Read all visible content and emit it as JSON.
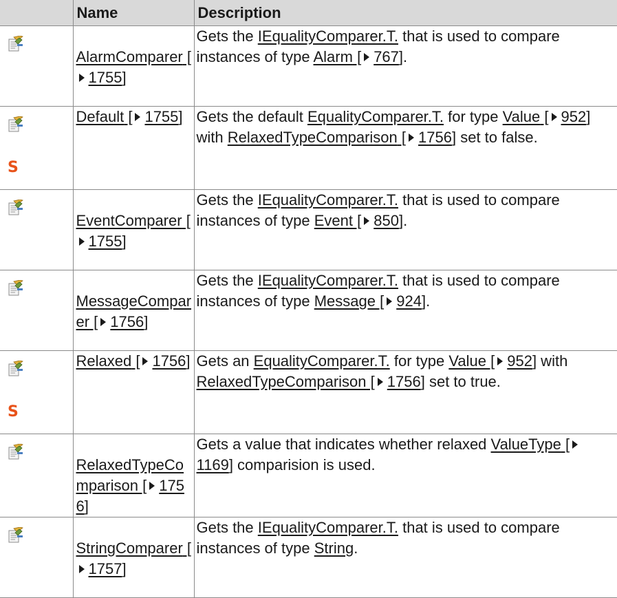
{
  "header": {
    "col_icon": "",
    "col_name": "Name",
    "col_desc": "Description"
  },
  "static_letter": "S",
  "rows": [
    {
      "name": {
        "text": "AlarmComparer",
        "ref": "1755"
      },
      "desc": [
        {
          "t": "Gets the "
        },
        {
          "t": "IEqualityComparer.T.",
          "link": true
        },
        {
          "t": " that is used to compare instances of type "
        },
        {
          "t": "Alarm",
          "link": true,
          "ref": "767"
        },
        {
          "t": "."
        }
      ]
    },
    {
      "name": {
        "text": "Default",
        "ref": "1755"
      },
      "static": true,
      "desc": [
        {
          "t": "Gets the default "
        },
        {
          "t": "EqualityComparer.T.",
          "link": true
        },
        {
          "t": " for type "
        },
        {
          "t": "Value",
          "link": true,
          "ref": "952"
        },
        {
          "t": " with "
        },
        {
          "t": "RelaxedTypeComparison",
          "link": true,
          "ref": "1756"
        },
        {
          "t": " set to false."
        }
      ]
    },
    {
      "name": {
        "text": "EventComparer",
        "ref": "1755"
      },
      "desc": [
        {
          "t": "Gets the "
        },
        {
          "t": "IEqualityComparer.T.",
          "link": true
        },
        {
          "t": " that is used to compare instances of type "
        },
        {
          "t": "Event",
          "link": true,
          "ref": "850"
        },
        {
          "t": "."
        }
      ]
    },
    {
      "name": {
        "text": "MessageComparer",
        "ref": "1756"
      },
      "desc": [
        {
          "t": "Gets the "
        },
        {
          "t": "IEqualityComparer.T.",
          "link": true
        },
        {
          "t": " that is used to compare instances of type "
        },
        {
          "t": "Message",
          "link": true,
          "ref": "924"
        },
        {
          "t": "."
        }
      ]
    },
    {
      "name": {
        "text": "Relaxed",
        "ref": "1756"
      },
      "static": true,
      "desc": [
        {
          "t": "Gets an "
        },
        {
          "t": "EqualityComparer.T.",
          "link": true
        },
        {
          "t": " for type "
        },
        {
          "t": "Value",
          "link": true,
          "ref": "952"
        },
        {
          "t": " with "
        },
        {
          "t": "RelaxedTypeComparison",
          "link": true,
          "ref": "1756"
        },
        {
          "t": " set to true."
        }
      ]
    },
    {
      "name": {
        "text": "RelaxedTypeComparison",
        "ref": "1756"
      },
      "desc": [
        {
          "t": "Gets a value that indicates whether relaxed "
        },
        {
          "t": "ValueType",
          "link": true,
          "ref": "1169"
        },
        {
          "t": " comparision is used."
        }
      ]
    },
    {
      "name": {
        "text": "StringComparer",
        "ref": "1757"
      },
      "desc": [
        {
          "t": "Gets the "
        },
        {
          "t": "IEqualityComparer.T.",
          "link": true
        },
        {
          "t": " that is used to compare instances of type "
        },
        {
          "t": "String",
          "link": true
        },
        {
          "t": "."
        }
      ]
    }
  ]
}
